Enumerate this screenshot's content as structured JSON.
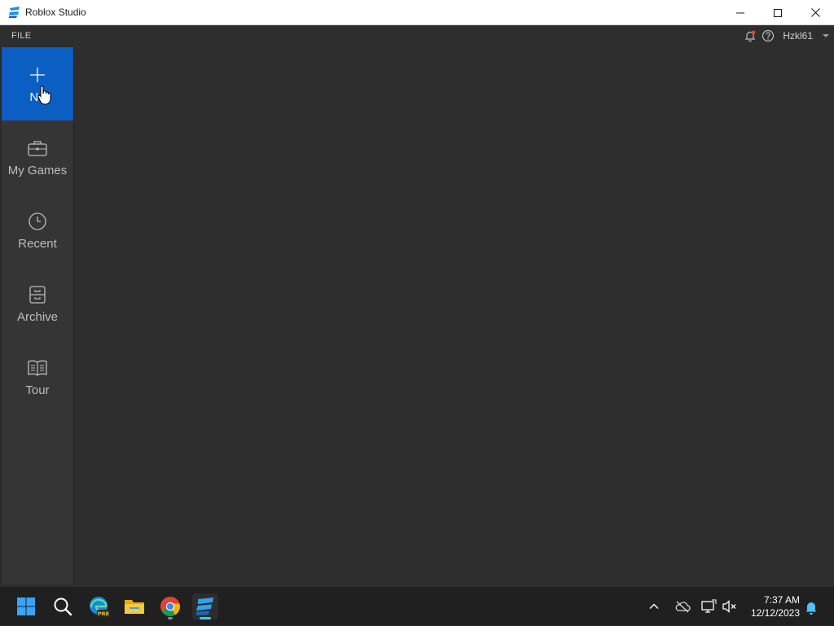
{
  "window": {
    "title": "Roblox Studio",
    "icon": "roblox-studio-icon",
    "controls": [
      "minimize-icon",
      "maximize-icon",
      "close-icon"
    ]
  },
  "menubar": {
    "file_label": "FILE",
    "notification_icon": "bell-icon",
    "help_icon": "help-icon",
    "username": "Hzkl61"
  },
  "sidebar": {
    "items": [
      {
        "label": "Ne",
        "icon": "plus-icon",
        "active": true
      },
      {
        "label": "My Games",
        "icon": "briefcase-icon",
        "active": false
      },
      {
        "label": "Recent",
        "icon": "clock-icon",
        "active": false
      },
      {
        "label": "Archive",
        "icon": "archive-icon",
        "active": false
      },
      {
        "label": "Tour",
        "icon": "book-icon",
        "active": false
      }
    ]
  },
  "taskbar": {
    "apps": [
      "start-icon",
      "search-icon",
      "edge-pre-icon",
      "file-explorer-icon",
      "chrome-icon",
      "roblox-studio-icon"
    ],
    "tray": [
      "chevron-up-icon",
      "onedrive-icon",
      "network-icon",
      "volume-muted-icon",
      "notification-bell-icon"
    ],
    "time": "7:37 AM",
    "date": "12/12/2023"
  },
  "colors": {
    "accent": "#0b5ec2",
    "background": "#2e2e2e",
    "sidebar": "#353535",
    "taskbar": "#202020"
  }
}
